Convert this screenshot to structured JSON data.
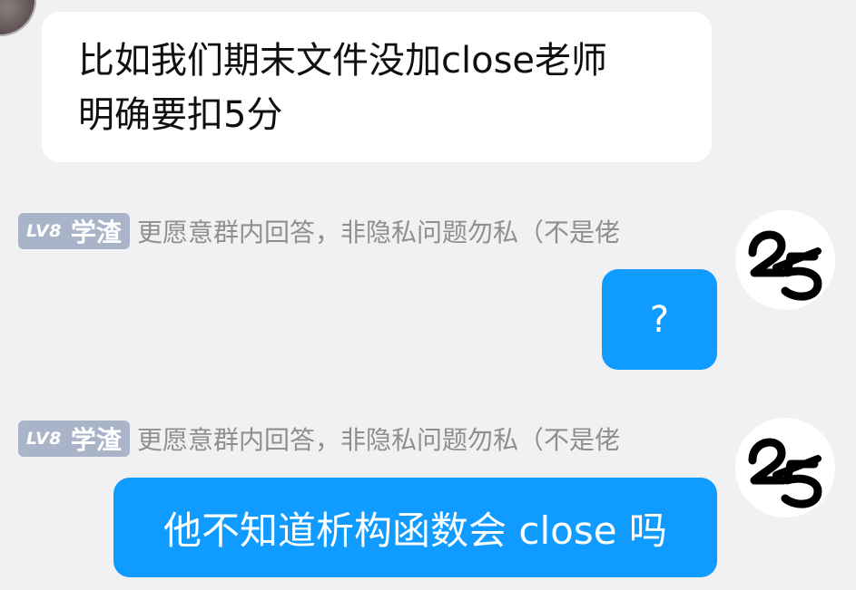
{
  "messages": [
    {
      "side": "left",
      "text_line1": "比如我们期末文件没加close老师",
      "text_line2": "明确要扣5分"
    },
    {
      "side": "right",
      "badge": {
        "level": "LV8",
        "title": "学渣"
      },
      "sender_note": "更愿意群内回答，非隐私问题勿私（不是佬",
      "text": "?"
    },
    {
      "side": "right",
      "badge": {
        "level": "LV8",
        "title": "学渣"
      },
      "sender_note": "更愿意群内回答，非隐私问题勿私（不是佬",
      "text": "他不知道析构函数会 close 吗"
    }
  ],
  "colors": {
    "background": "#f1f1f3",
    "incoming_bubble": "#ffffff",
    "outgoing_bubble": "#0f9bff",
    "badge": "#a9b4c9",
    "meta_text": "#8f8f8f"
  },
  "icons": {
    "sender_avatar": "avatar-2-over-5-logo",
    "partial_avatar": "avatar"
  }
}
